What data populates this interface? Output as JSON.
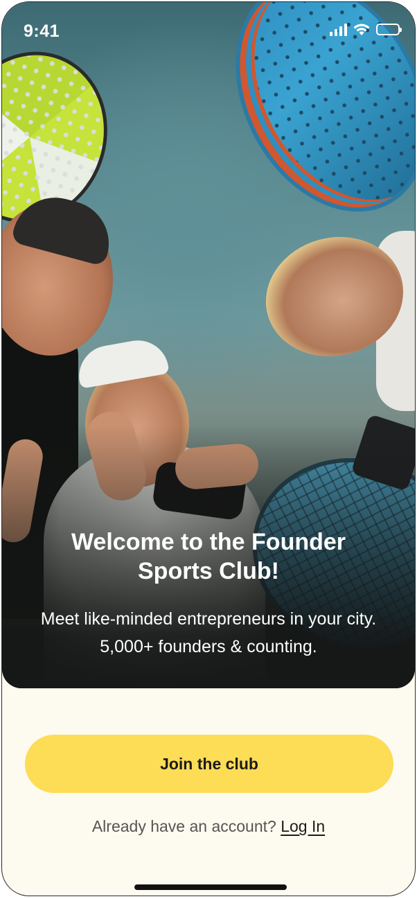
{
  "status_bar": {
    "time": "9:41"
  },
  "hero": {
    "title": "Welcome to the Founder Sports Club!",
    "subtitle": "Meet like-minded entrepreneurs in your city. 5,000+ founders & counting."
  },
  "actions": {
    "join_label": "Join the club",
    "login_prompt": "Already have an account?",
    "login_link": "Log In"
  },
  "colors": {
    "primary_button": "#fddc56",
    "background": "#fdfaef",
    "hero_text": "#ffffff"
  },
  "icons": {
    "status": [
      "signal-icon",
      "wifi-icon",
      "battery-icon"
    ]
  }
}
